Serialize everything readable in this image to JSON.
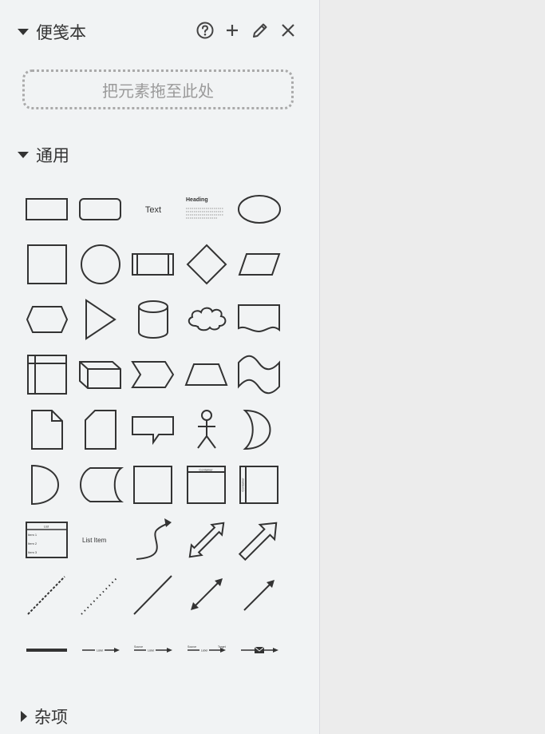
{
  "scratchpad": {
    "title": "便笺本",
    "drop_hint": "把元素拖至此处",
    "tools": [
      "help-icon",
      "plus-icon",
      "pencil-icon",
      "close-icon"
    ]
  },
  "general": {
    "title": "通用",
    "labels": {
      "text": "Text",
      "heading": "Heading",
      "lorem": "Lorem ipsum dolor sit amet, consectetur adipisicing elit, sed do eiusmod tempor incididunt ut labore et dolore magna aliqua.",
      "container_title": "Container",
      "list_title": "List",
      "list_items": [
        "Item 1",
        "Item 2",
        "Item 3"
      ],
      "list_item": "List Item",
      "connector_label": "Label",
      "source": "Source",
      "target": "Target"
    }
  },
  "misc": {
    "title": "杂项"
  },
  "colors": {
    "stroke": "#333333",
    "fill": "#f1f3f4",
    "panel_bg": "#f1f3f4",
    "canvas_bg": "#ececec"
  }
}
